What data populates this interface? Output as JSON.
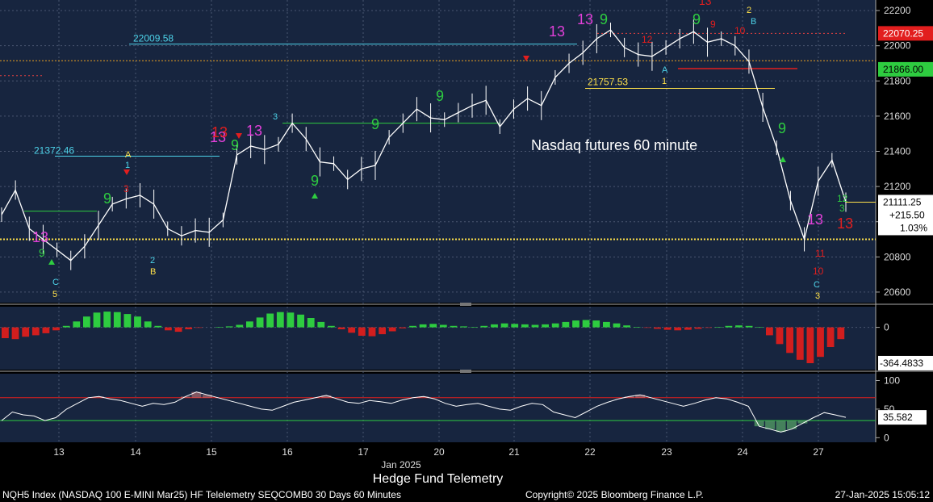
{
  "chart_data": [
    {
      "type": "line",
      "panel": "price",
      "series_name": "NQH5 Index",
      "annotation": "Nasdaq futures 60 minute",
      "ylim": [
        20540,
        22260
      ],
      "y_ticks": [
        "22200",
        "22000",
        "21800",
        "21600",
        "21400",
        "21200",
        "21000",
        "20800",
        "20600"
      ],
      "x_categories": [
        "13",
        "14",
        "15",
        "16",
        "17",
        "20",
        "21",
        "22",
        "23",
        "24",
        "27"
      ],
      "x_sub_label": "Jan 2025",
      "last_price": "21111.25",
      "change": "+215.50",
      "change_pct": "1.03%",
      "marker_levels": [
        "22070.25",
        "21866.00"
      ],
      "level_labels": [
        "22009.58",
        "21372.46",
        "21757.53"
      ],
      "closes": [
        21040,
        21180,
        20960,
        20900,
        20840,
        20780,
        20860,
        20980,
        21100,
        21130,
        21150,
        21100,
        20960,
        20920,
        20950,
        20940,
        21010,
        21380,
        21430,
        21410,
        21440,
        21560,
        21470,
        21340,
        21330,
        21240,
        21300,
        21320,
        21480,
        21560,
        21640,
        21590,
        21580,
        21620,
        21660,
        21690,
        21540,
        21640,
        21700,
        21660,
        21820,
        21900,
        21960,
        22040,
        22090,
        21990,
        21950,
        21940,
        21990,
        22040,
        22080,
        22020,
        22040,
        22000,
        21910,
        21650,
        21420,
        21120,
        20900,
        21230,
        21350,
        21111
      ]
    },
    {
      "type": "bar",
      "panel": "oscillator",
      "ylim": [
        -430,
        210
      ],
      "y_ticks": [
        "0"
      ],
      "last_value": "-364.4833",
      "values": [
        -110,
        -120,
        -95,
        -80,
        -60,
        -30,
        15,
        60,
        110,
        150,
        160,
        155,
        135,
        110,
        60,
        15,
        -30,
        -45,
        -20,
        -5,
        0,
        5,
        10,
        25,
        60,
        100,
        140,
        155,
        150,
        130,
        95,
        55,
        15,
        -20,
        -55,
        -85,
        -90,
        -70,
        -40,
        -10,
        15,
        30,
        35,
        25,
        15,
        10,
        5,
        15,
        30,
        40,
        35,
        30,
        25,
        30,
        40,
        55,
        70,
        75,
        70,
        55,
        40,
        20,
        5,
        -5,
        -15,
        -25,
        -30,
        -25,
        -15,
        -5,
        5,
        15,
        20,
        15,
        5,
        -80,
        -170,
        -260,
        -330,
        -364,
        -300,
        -200,
        -120
      ]
    },
    {
      "type": "line",
      "panel": "rsi",
      "ylim": [
        -8,
        112
      ],
      "y_ticks": [
        "100",
        "50",
        "0"
      ],
      "upper_band": 70,
      "lower_band": 30,
      "last_value": "35.582",
      "values": [
        30,
        45,
        40,
        38,
        30,
        35,
        50,
        60,
        70,
        72,
        68,
        65,
        60,
        55,
        60,
        58,
        62,
        72,
        80,
        75,
        70,
        65,
        60,
        55,
        50,
        48,
        55,
        62,
        66,
        70,
        74,
        68,
        62,
        60,
        65,
        63,
        60,
        66,
        70,
        72,
        68,
        60,
        55,
        58,
        60,
        55,
        50,
        48,
        55,
        60,
        58,
        45,
        40,
        35,
        45,
        55,
        62,
        68,
        72,
        75,
        70,
        65,
        60,
        55,
        60,
        66,
        70,
        68,
        62,
        55,
        20,
        15,
        10,
        15,
        25,
        35,
        44,
        40,
        35.6
      ]
    }
  ],
  "footer": {
    "title": "Hedge Fund Telemetry",
    "left": "NQH5 Index (NASDAQ 100 E-MINI Mar25) HF Telelemetry SEQCOMB0 30 Days 60 Minutes",
    "copyright": "Copyright© 2025 Bloomberg Finance L.P.",
    "timestamp": "27-Jan-2025 15:05:12"
  },
  "colors": {
    "background": "#17253f",
    "grid": "#4a5670",
    "price_line": "#ffffff",
    "buy_count": "#2ecc40",
    "sell_count": "#e21e1e",
    "thirteen": "#e040d8",
    "cyan_level": "#4dd2e8",
    "yellow_level": "#ffe14a",
    "orange_dotted": "#e8a020",
    "osc_pos": "#2ecc40",
    "osc_neg": "#d21e1e",
    "rsi_line": "#ffffff",
    "rsi_upper": "#e21e1e",
    "rsi_lower": "#2ecc40"
  }
}
